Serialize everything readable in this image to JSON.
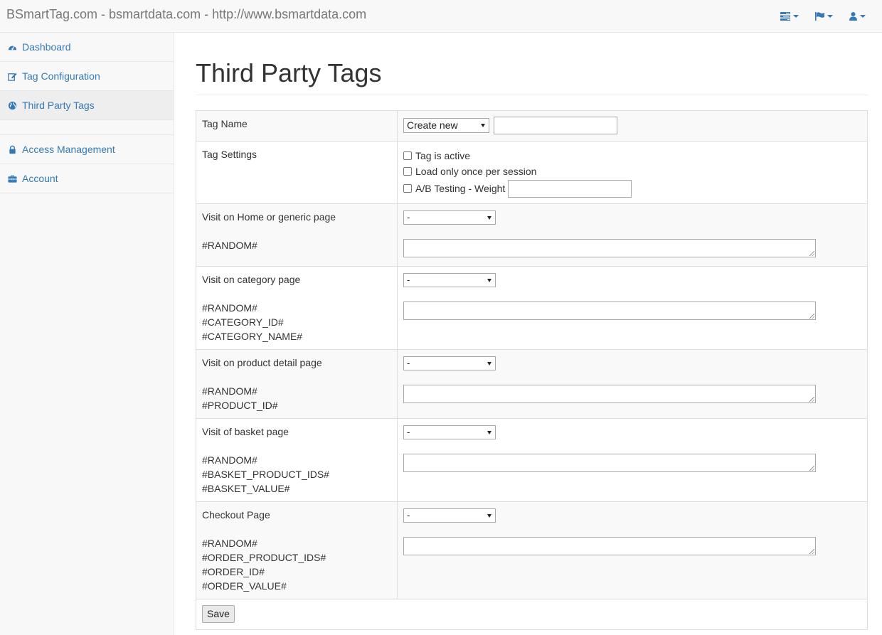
{
  "navbar": {
    "brand": "BSmartTag.com - bsmartdata.com - http://www.bsmartdata.com",
    "menus": [
      {
        "icon": "tasks-icon"
      },
      {
        "icon": "flag-icon"
      },
      {
        "icon": "user-icon"
      }
    ]
  },
  "sidebar": {
    "items": [
      {
        "label": "Dashboard",
        "icon": "dashboard-icon"
      },
      {
        "label": "Tag Configuration",
        "icon": "edit-icon"
      },
      {
        "label": "Third Party Tags",
        "icon": "globe-icon",
        "active": true
      },
      {
        "label": "Access Management",
        "icon": "lock-icon"
      },
      {
        "label": "Account",
        "icon": "briefcase-icon"
      }
    ]
  },
  "page": {
    "title": "Third Party Tags"
  },
  "form": {
    "tag_name": {
      "label": "Tag Name",
      "select_value": "Create new",
      "input_value": ""
    },
    "tag_settings": {
      "label": "Tag Settings",
      "options": [
        {
          "label": "Tag is active",
          "checked": false
        },
        {
          "label": "Load only once per session",
          "checked": false
        },
        {
          "label": "A/B Testing - Weight",
          "checked": false
        }
      ],
      "weight_value": ""
    },
    "pages": [
      {
        "label": "Visit on Home or generic page",
        "select_value": "-",
        "vars": [
          "#RANDOM#"
        ]
      },
      {
        "label": "Visit on category page",
        "select_value": "-",
        "vars": [
          "#RANDOM#",
          "#CATEGORY_ID#",
          "#CATEGORY_NAME#"
        ]
      },
      {
        "label": "Visit on product detail page",
        "select_value": "-",
        "vars": [
          "#RANDOM#",
          "#PRODUCT_ID#"
        ]
      },
      {
        "label": "Visit of basket page",
        "select_value": "-",
        "vars": [
          "#RANDOM#",
          "#BASKET_PRODUCT_IDS#",
          "#BASKET_VALUE#"
        ]
      },
      {
        "label": "Checkout Page",
        "select_value": "-",
        "vars": [
          "#RANDOM#",
          "#ORDER_PRODUCT_IDS#",
          "#ORDER_ID#",
          "#ORDER_VALUE#"
        ]
      }
    ],
    "save_label": "Save"
  },
  "colors": {
    "link": "#337ab7",
    "navbar_bg": "#f8f8f8",
    "border": "#ddd"
  }
}
